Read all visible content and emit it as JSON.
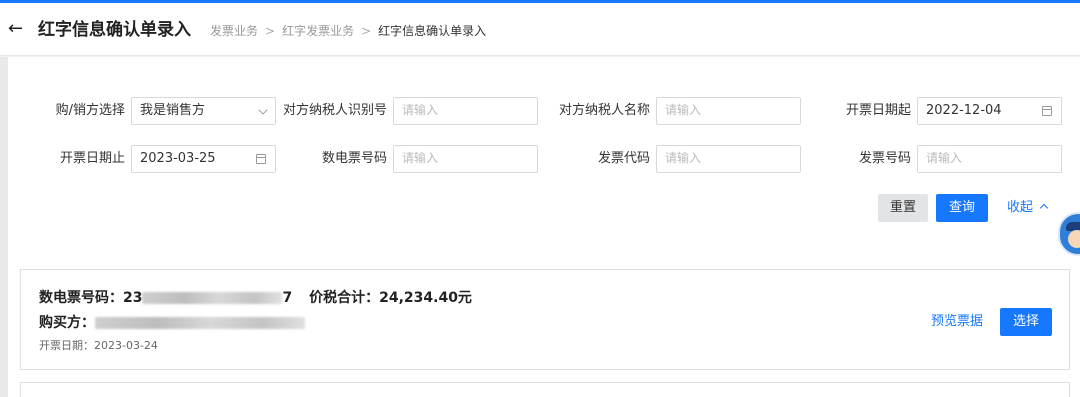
{
  "header": {
    "back_icon": "←",
    "title": "红字信息确认单录入",
    "breadcrumbs": [
      "发票业务",
      "红字发票业务",
      "红字信息确认单录入"
    ]
  },
  "filters": {
    "buy_sell": {
      "label": "购/销方选择",
      "value": "我是销售方"
    },
    "counterparty_tax_id": {
      "label": "对方纳税人识别号",
      "placeholder": "请输入"
    },
    "counterparty_name": {
      "label": "对方纳税人名称",
      "placeholder": "请输入"
    },
    "issue_date_start": {
      "label": "开票日期起",
      "value": "2022-12-04"
    },
    "issue_date_end": {
      "label": "开票日期止",
      "value": "2023-03-25"
    },
    "e_invoice_number": {
      "label": "数电票号码",
      "placeholder": "请输入"
    },
    "invoice_code": {
      "label": "发票代码",
      "placeholder": "请输入"
    },
    "invoice_number": {
      "label": "发票号码",
      "placeholder": "请输入"
    }
  },
  "actions": {
    "reset": "重置",
    "query": "查询",
    "collapse": "收起"
  },
  "result": {
    "e_invoice_label": "数电票号码：",
    "e_invoice_prefix": "23",
    "e_invoice_suffix": "7",
    "total_label": "价税合计：",
    "total_value": "24,234.40元",
    "buyer_label": "购买方：",
    "issue_date_label": "开票日期：",
    "issue_date_value": "2023-03-24",
    "preview": "预览票据",
    "select": "选择"
  },
  "colors": {
    "accent": "#1677ff"
  }
}
